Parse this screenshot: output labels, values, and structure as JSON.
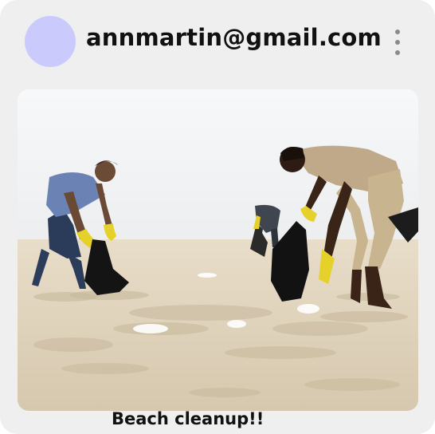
{
  "post": {
    "author_email": "annmartin@gmail.com",
    "caption": "Beach cleanup!!"
  },
  "icons": {
    "more": "more-vertical-icon"
  },
  "colors": {
    "card_background": "#efefef",
    "avatar": "#cacbfc",
    "text": "#111111"
  }
}
